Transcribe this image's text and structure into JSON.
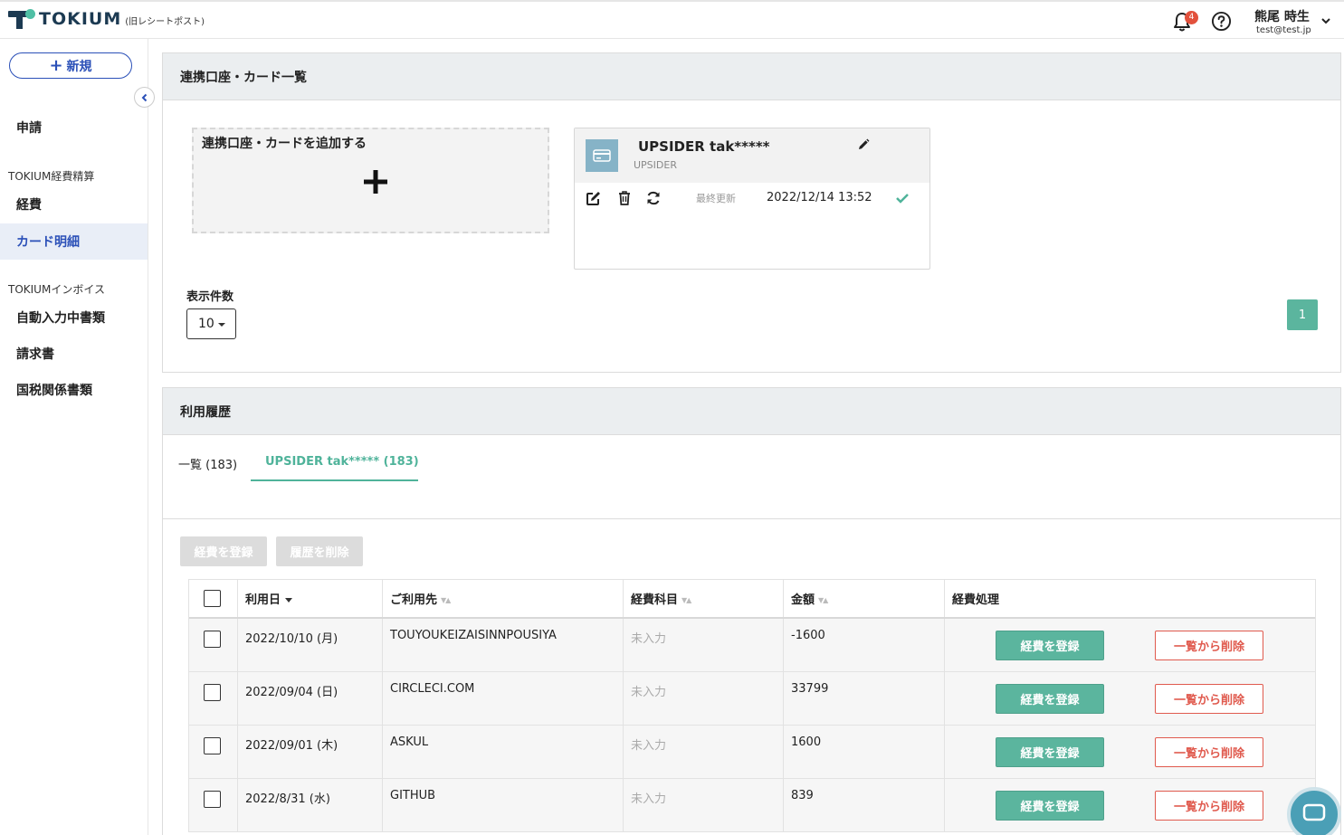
{
  "header": {
    "logo_text": "TOKIUM",
    "logo_sub": "(旧レシートポスト)",
    "notification_count": "4",
    "user_name": "熊尾 時生",
    "user_email": "test@test.jp"
  },
  "sidebar": {
    "new_label": "新規",
    "items": [
      {
        "label": "申請"
      },
      {
        "label": "経費"
      },
      {
        "label": "カード明細"
      },
      {
        "label": "自動入力中書類"
      },
      {
        "label": "請求書"
      },
      {
        "label": "国税関係書類"
      }
    ],
    "groups": [
      "TOKIUM経費精算",
      "TOKIUMインボイス"
    ]
  },
  "accounts_panel": {
    "title": "連携口座・カード一覧",
    "add_label": "連携口座・カードを追加する",
    "card": {
      "name": "UPSIDER tak*****",
      "issuer": "UPSIDER",
      "last_updated_label": "最終更新",
      "last_updated": "2022/12/14 13:52"
    },
    "per_page_label": "表示件数",
    "per_page_value": "10",
    "page": "1"
  },
  "history_panel": {
    "title": "利用履歴",
    "tabs": [
      "一覧 (183)",
      "UPSIDER tak***** (183)"
    ],
    "register_button": "経費を登録",
    "delete_button": "履歴を削除",
    "columns": [
      "利用日",
      "ご利用先",
      "経費科目",
      "金額",
      "経費処理"
    ],
    "rows": [
      {
        "date": "2022/10/10 (月)",
        "payee": "TOUYOUKEIZAISINNPOUSIYA",
        "category": "未入力",
        "amount": "-1600"
      },
      {
        "date": "2022/09/04 (日)",
        "payee": "CIRCLECI.COM",
        "category": "未入力",
        "amount": "33799"
      },
      {
        "date": "2022/09/01 (木)",
        "payee": "ASKUL",
        "category": "未入力",
        "amount": "1600"
      },
      {
        "date": "2022/8/31 (水)",
        "payee": "GITHUB",
        "category": "未入力",
        "amount": "839"
      }
    ],
    "row_register": "経費を登録",
    "row_remove": "一覧から削除"
  }
}
